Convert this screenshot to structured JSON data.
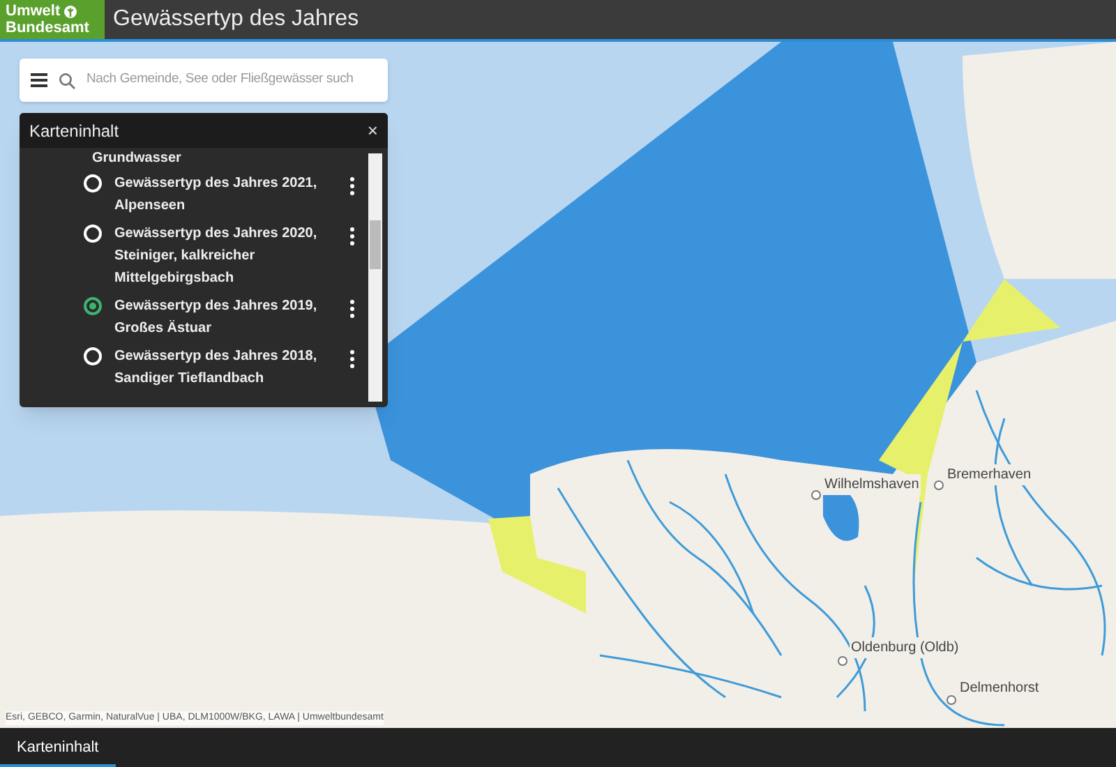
{
  "header": {
    "logo": [
      "Umwelt",
      "Bundesamt"
    ],
    "title": "Gewässertyp des Jahres"
  },
  "search": {
    "placeholder": "Nach Gemeinde, See oder Fließgewässer such"
  },
  "panel": {
    "title": "Karteninhalt",
    "close": "×",
    "items": [
      {
        "kind": "text",
        "label": "Grundwasser"
      },
      {
        "kind": "radio",
        "label": "Gewässertyp des Jahres 2021, Alpenseen",
        "selected": false
      },
      {
        "kind": "radio",
        "label": "Gewässertyp des Jahres 2020, Steiniger, kalkreicher Mittelgebirgsbach",
        "selected": false
      },
      {
        "kind": "radio",
        "label": "Gewässertyp des Jahres 2019, Großes Ästuar",
        "selected": true
      },
      {
        "kind": "radio",
        "label": "Gewässertyp des Jahres 2018, Sandiger Tieflandbach",
        "selected": false
      }
    ]
  },
  "map": {
    "places": [
      {
        "name": "Wilhelmshaven"
      },
      {
        "name": "Bremerhaven"
      },
      {
        "name": "Oldenburg (Oldb)"
      },
      {
        "name": "Delmenhorst"
      }
    ],
    "attribution": "Esri, GEBCO, Garmin, NaturalVue | UBA, DLM1000W/BKG, LAWA | Umweltbundesamt"
  },
  "bottom_tabs": [
    {
      "label": "Karteninhalt",
      "selected": true
    }
  ]
}
